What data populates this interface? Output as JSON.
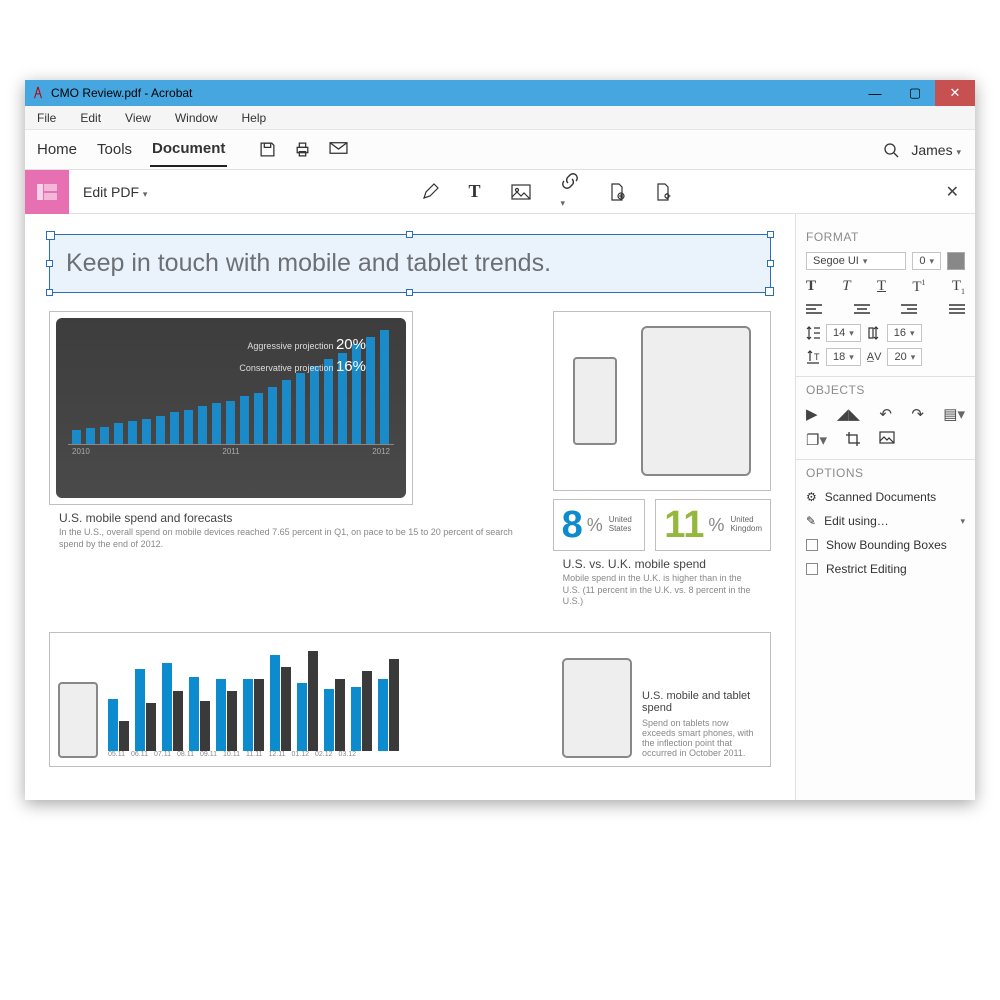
{
  "titlebar": {
    "title": "CMO Review.pdf - Acrobat"
  },
  "menubar": [
    "File",
    "Edit",
    "View",
    "Window",
    "Help"
  ],
  "tabs": {
    "home": "Home",
    "tools": "Tools",
    "document": "Document"
  },
  "user": "James",
  "editbar": {
    "label": "Edit PDF"
  },
  "doc": {
    "headline": "Keep in touch with mobile and tablet trends.",
    "chart1": {
      "proj1_label": "Aggressive projection ",
      "proj1_val": "20%",
      "proj2_label": "Conservative projection ",
      "proj2_val": "16%",
      "xlabels": [
        "2010",
        "2011",
        "2012"
      ]
    },
    "caption1": {
      "title": "U.S. mobile spend and forecasts",
      "desc": "In the U.S., overall spend on mobile devices reached 7.65 percent in Q1, on pace to be 15 to 20 percent of search spend by the end of 2012."
    },
    "stat1": {
      "big": "8",
      "pct": "%",
      "lbl": "United\nStates",
      "color": "#0d8bcf"
    },
    "stat2": {
      "big": "11",
      "pct": "%",
      "lbl": "United\nKingdom",
      "color": "#94b83d"
    },
    "caption2": {
      "title": "U.S. vs. U.K. mobile spend",
      "desc": "Mobile spend in the U.K. is higher than in the U.S. (11 percent in the U.K. vs. 8 percent in the U.S.)"
    },
    "chart2_labels": [
      "05.11",
      "06.11",
      "07.11",
      "08.11",
      "09.11",
      "10.11",
      "11.11",
      "12.11",
      "01.12",
      "02.12",
      "03.12"
    ],
    "caption3": {
      "title": "U.S. mobile and tablet spend",
      "desc": "Spend on tablets now exceeds smart phones, with the inflection point that occurred in October 2011."
    }
  },
  "panel": {
    "sect_format": "FORMAT",
    "font": "Segoe UI",
    "size": "0",
    "lh_left": "14",
    "lh_right": "16",
    "sp_left": "18",
    "sp_right": "20",
    "sect_objects": "OBJECTS",
    "sect_options": "OPTIONS",
    "opt_scanned": "Scanned Documents",
    "opt_edit": "Edit using…",
    "opt_bbox": "Show Bounding Boxes",
    "opt_restrict": "Restrict Editing"
  }
}
